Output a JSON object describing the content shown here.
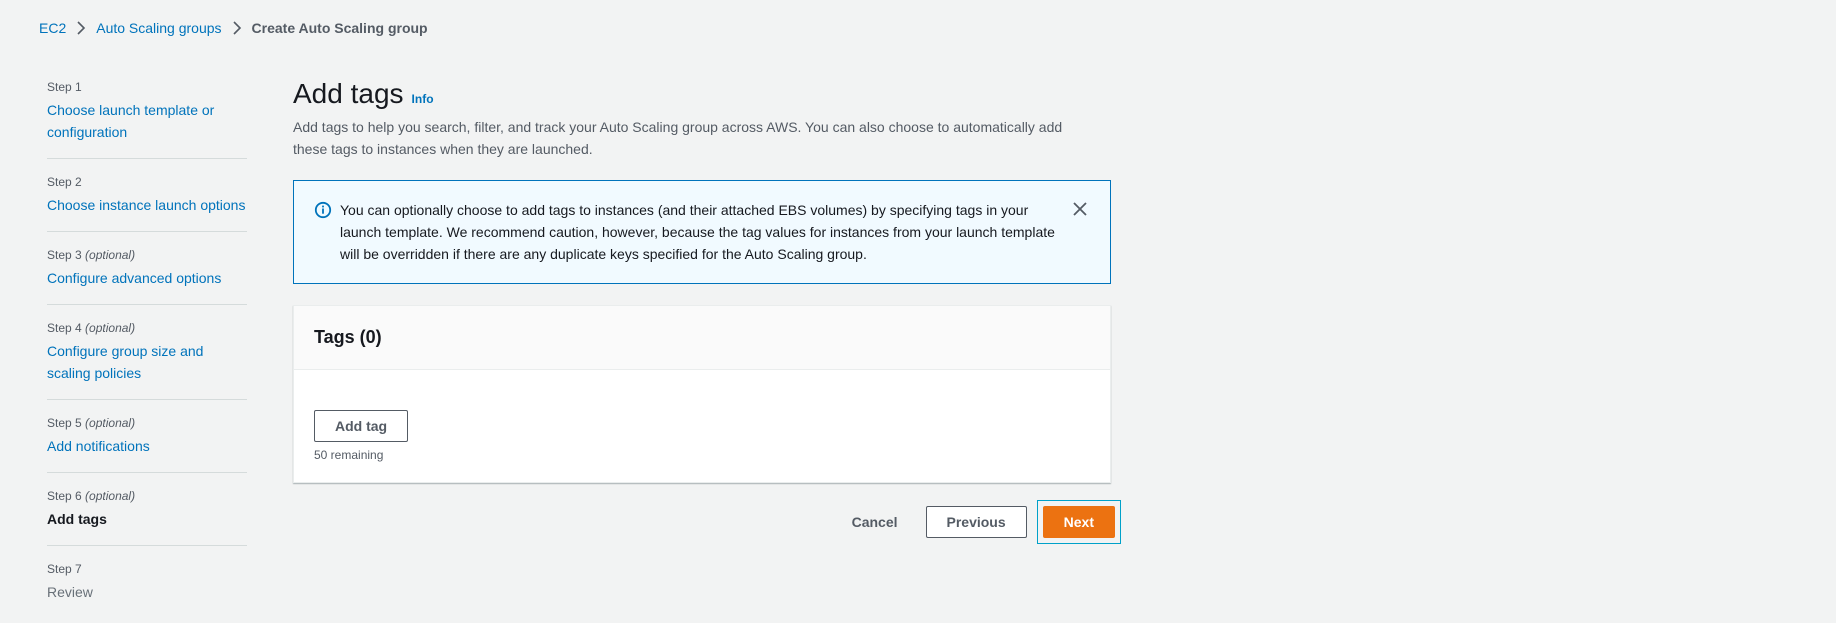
{
  "breadcrumb": {
    "items": [
      "EC2",
      "Auto Scaling groups"
    ],
    "current": "Create Auto Scaling group"
  },
  "steps": [
    {
      "num": "Step 1",
      "optional": "",
      "label": "Choose launch template or configuration",
      "state": "link"
    },
    {
      "num": "Step 2",
      "optional": "",
      "label": "Choose instance launch options",
      "state": "link"
    },
    {
      "num": "Step 3",
      "optional": "(optional)",
      "label": "Configure advanced options",
      "state": "link"
    },
    {
      "num": "Step 4",
      "optional": "(optional)",
      "label": "Configure group size and scaling policies",
      "state": "link"
    },
    {
      "num": "Step 5",
      "optional": "(optional)",
      "label": "Add notifications",
      "state": "link"
    },
    {
      "num": "Step 6",
      "optional": "(optional)",
      "label": "Add tags",
      "state": "active"
    },
    {
      "num": "Step 7",
      "optional": "",
      "label": "Review",
      "state": "disabled"
    }
  ],
  "page": {
    "title": "Add tags",
    "info_link": "Info",
    "description": "Add tags to help you search, filter, and track your Auto Scaling group across AWS. You can also choose to automatically add these tags to instances when they are launched."
  },
  "alert": {
    "text": "You can optionally choose to add tags to instances (and their attached EBS volumes) by specifying tags in your launch template. We recommend caution, however, because the tag values for instances from your launch template will be overridden if there are any duplicate keys specified for the Auto Scaling group."
  },
  "tags_panel": {
    "title": "Tags (0)",
    "add_button": "Add tag",
    "remaining": "50 remaining"
  },
  "actions": {
    "cancel": "Cancel",
    "previous": "Previous",
    "next": "Next"
  },
  "colors": {
    "link": "#0073bb",
    "primary": "#ec7211",
    "alert_border": "#0073bb",
    "alert_bg": "#f1faff",
    "focus_ring": "#00a1c9"
  }
}
